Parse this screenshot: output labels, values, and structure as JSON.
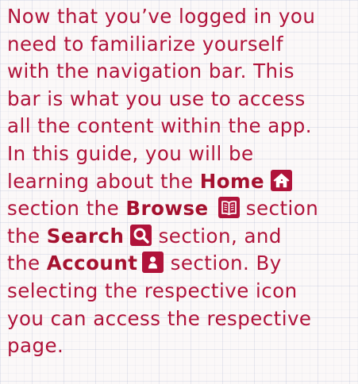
{
  "guide": {
    "lines": [
      "Now that you’ve logged in you",
      "need to familiarize yourself",
      "with the navigation bar. This",
      "bar is what you use to access",
      "all the content within the app."
    ],
    "line6": "In this guide, you will be",
    "line7_pre": "learning about the ",
    "line8_pre": "section the ",
    "line8_post": " section",
    "line9_pre": "the ",
    "line9_post": " section, and",
    "line10_pre": "the ",
    "line10_post": " section. By",
    "line11": "selecting the respective icon",
    "line12": "you can access the respective",
    "line13": "page."
  },
  "nav_sections": {
    "home": {
      "label": "Home",
      "icon": "home-icon"
    },
    "browse": {
      "label": "Browse",
      "icon": "book-icon"
    },
    "search": {
      "label": "Search",
      "icon": "search-icon"
    },
    "account": {
      "label": "Account",
      "icon": "user-icon"
    }
  },
  "colors": {
    "text": "#b0133a",
    "keyword": "#a5112f",
    "icon_background": "#b0133a",
    "icon_glyph": "#ffffff",
    "page_background": "#fbf8f8"
  }
}
